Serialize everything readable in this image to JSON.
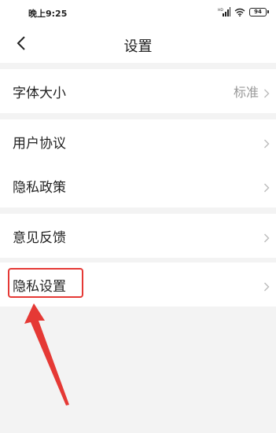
{
  "status_bar": {
    "time": "晚上9:25",
    "battery": "94"
  },
  "header": {
    "title": "设置"
  },
  "groups": [
    {
      "items": [
        {
          "label": "字体大小",
          "value": "标准"
        }
      ]
    },
    {
      "items": [
        {
          "label": "用户协议"
        },
        {
          "label": "隐私政策"
        }
      ]
    },
    {
      "items": [
        {
          "label": "意见反馈"
        }
      ]
    },
    {
      "items": [
        {
          "label": "隐私设置"
        }
      ]
    }
  ],
  "colors": {
    "background": "#f3f3f3",
    "annotation": "#e53935",
    "chevron": "#bbbbbb",
    "value_text": "#999999"
  }
}
